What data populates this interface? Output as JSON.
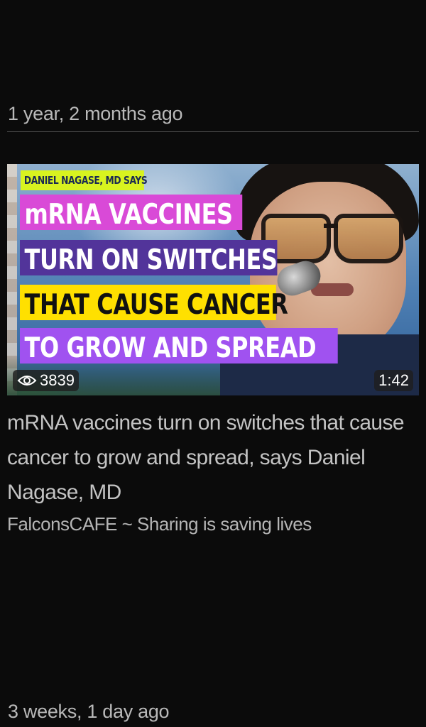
{
  "feed": {
    "items": [
      {
        "timestamp": "1 year, 2 months ago",
        "thumbnail": {
          "tag": "DANIEL NAGASE, MD SAYS",
          "lines": [
            "mRNA VACCINES",
            "TURN ON SWITCHES",
            "THAT CAUSE CANCER",
            "TO GROW AND SPREAD"
          ],
          "views": "3839",
          "duration": "1:42",
          "colors": {
            "tag_bg": "#d8f31f",
            "line1_bg": "#d94ad7",
            "line2_bg": "#52349a",
            "line3_bg": "#ffe000",
            "line4_bg": "#a052f0"
          }
        },
        "title": "mRNA vaccines turn on switches that cause cancer to grow and spread, says Daniel Nagase, MD",
        "channel": "FalconsCAFE ~ Sharing is saving lives"
      }
    ],
    "next_timestamp": "3 weeks, 1 day ago"
  },
  "icons": {
    "views": "eye-icon"
  },
  "theme": {
    "background": "#0b0b0b",
    "text_primary": "#c3c3c3",
    "text_secondary": "#b4b4b4"
  }
}
